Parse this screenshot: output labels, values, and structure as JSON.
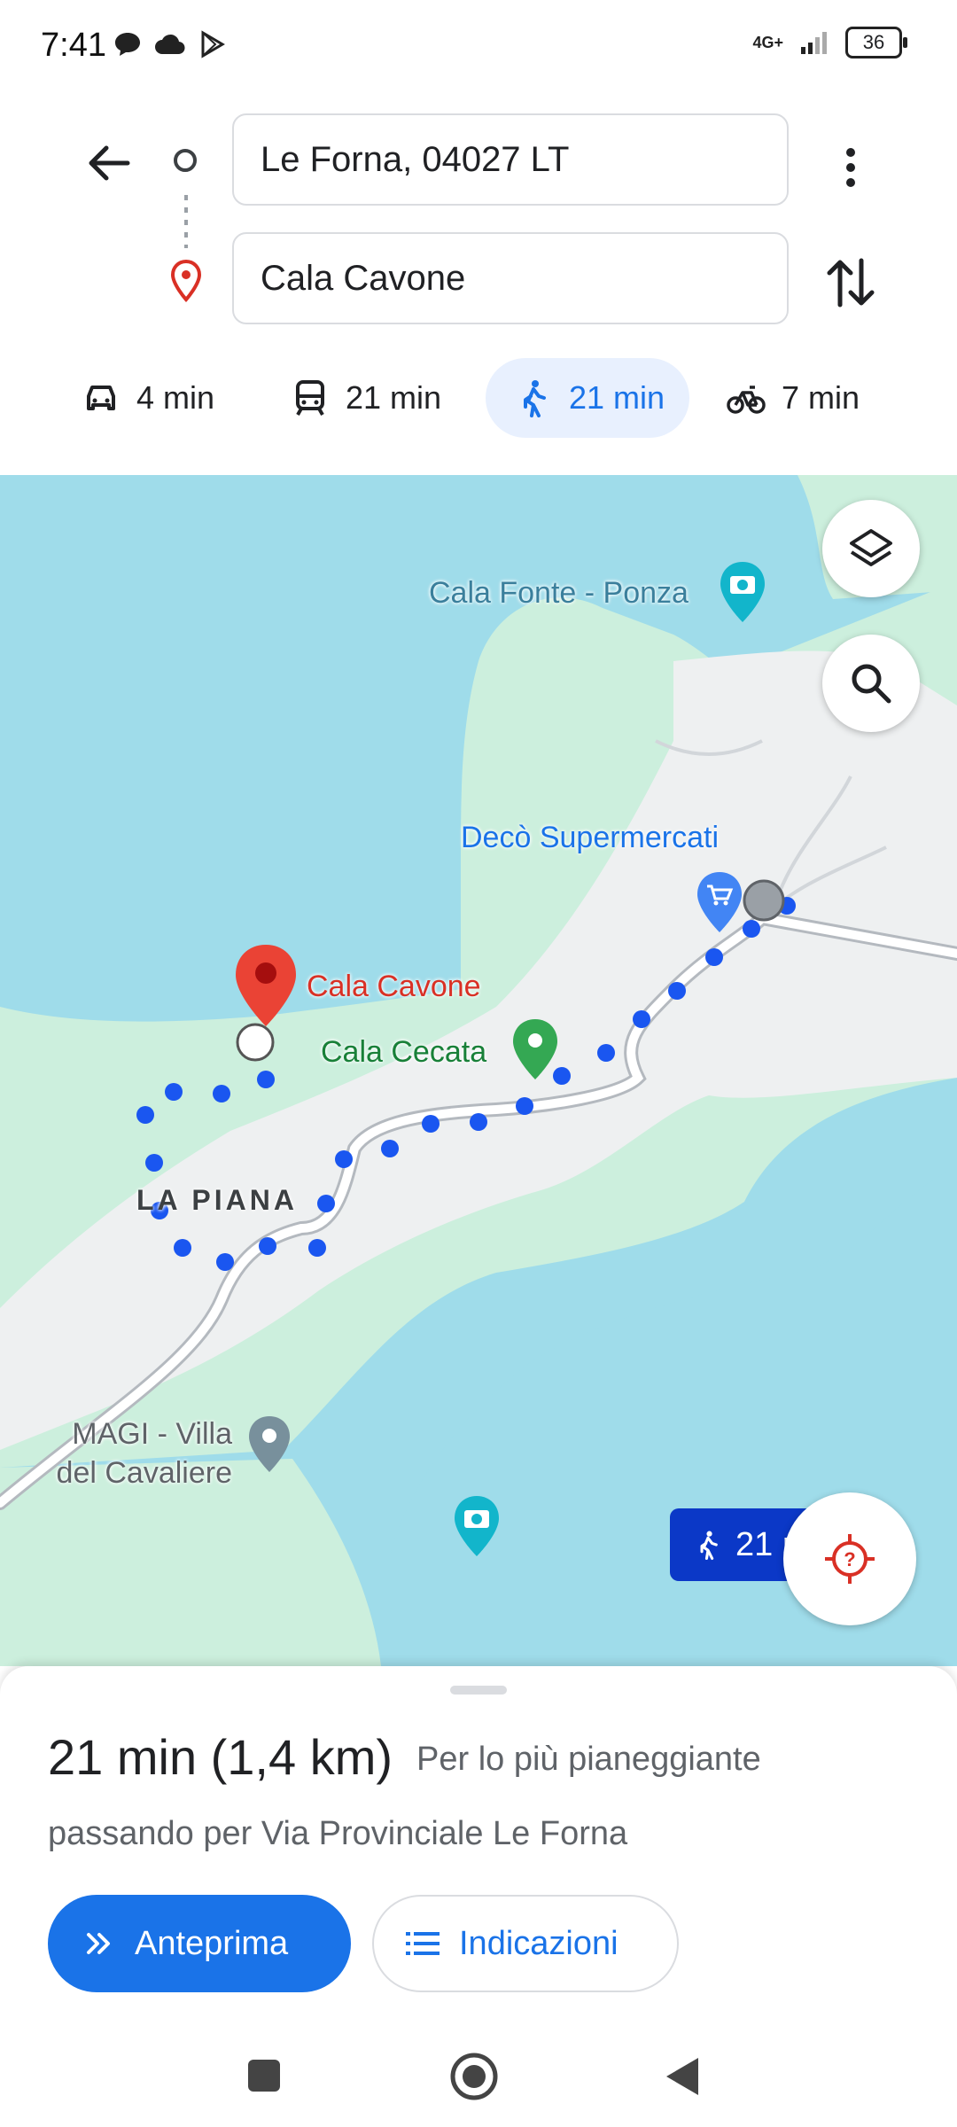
{
  "status_bar": {
    "time": "7:41",
    "network": "4G+",
    "battery": "36",
    "icons": [
      "chat-bubble-icon",
      "cloud-icon",
      "play-store-icon",
      "signal-icon",
      "battery-icon"
    ]
  },
  "route": {
    "origin": "Le Forna, 04027 LT",
    "destination": "Cala Cavone"
  },
  "modes": [
    {
      "name": "car",
      "label": "4 min",
      "icon": "car-icon",
      "active": false
    },
    {
      "name": "transit",
      "label": "21 min",
      "icon": "train-icon",
      "active": false
    },
    {
      "name": "walk",
      "label": "21 min",
      "icon": "walk-icon",
      "active": true
    },
    {
      "name": "bike",
      "label": "7 min",
      "icon": "bike-icon",
      "active": false
    }
  ],
  "map": {
    "labels": {
      "cala_fonte": "Cala Fonte - Ponza",
      "deco": "Decò Supermercati",
      "cala_cavone": "Cala Cavone",
      "cala_cecata": "Cala Cecata",
      "la_piana": "LA PIANA",
      "magi_line1": "MAGI - Villa",
      "magi_line2": "del Cavaliere"
    },
    "route_chip": "21 min",
    "colors": {
      "water": "#9fdcea",
      "land": "#ccefdd",
      "urban": "#f1f3f4",
      "route": "#1a56f0",
      "chip": "#0b38c7",
      "pin_red": "#ea4335",
      "pin_green": "#34a853",
      "pin_blue": "#4285f4",
      "pin_teal": "#12b5cb"
    }
  },
  "summary": {
    "time_distance": "21 min (1,4 km)",
    "terrain": "Per lo più pianeggiante",
    "via": "passando per Via Provinciale Le Forna",
    "preview_label": "Anteprima",
    "directions_label": "Indicazioni"
  }
}
